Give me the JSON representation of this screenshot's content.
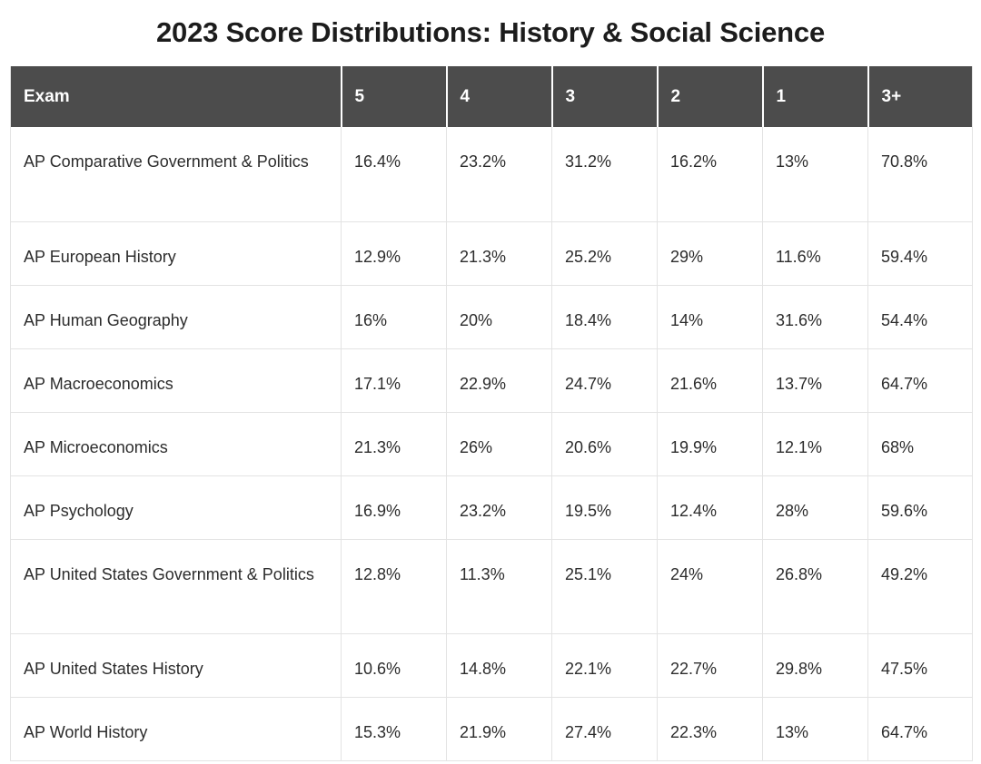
{
  "title": "2023 Score Distributions: History & Social Science",
  "table": {
    "columns": [
      "Exam",
      "5",
      "4",
      "3",
      "2",
      "1",
      "3+"
    ],
    "rows": [
      {
        "exam": "AP Comparative Government & Politics",
        "s5": "16.4%",
        "s4": "23.2%",
        "s3": "31.2%",
        "s2": "16.2%",
        "s1": "13%",
        "s3plus": "70.8%",
        "tall": true
      },
      {
        "exam": "AP European History",
        "s5": "12.9%",
        "s4": "21.3%",
        "s3": "25.2%",
        "s2": "29%",
        "s1": "11.6%",
        "s3plus": "59.4%",
        "tall": false
      },
      {
        "exam": "AP Human Geography",
        "s5": "16%",
        "s4": "20%",
        "s3": "18.4%",
        "s2": "14%",
        "s1": "31.6%",
        "s3plus": "54.4%",
        "tall": false
      },
      {
        "exam": "AP Macroeconomics",
        "s5": "17.1%",
        "s4": "22.9%",
        "s3": "24.7%",
        "s2": "21.6%",
        "s1": "13.7%",
        "s3plus": "64.7%",
        "tall": false
      },
      {
        "exam": "AP Microeconomics",
        "s5": "21.3%",
        "s4": "26%",
        "s3": "20.6%",
        "s2": "19.9%",
        "s1": "12.1%",
        "s3plus": "68%",
        "tall": false
      },
      {
        "exam": "AP Psychology",
        "s5": "16.9%",
        "s4": "23.2%",
        "s3": "19.5%",
        "s2": "12.4%",
        "s1": "28%",
        "s3plus": "59.6%",
        "tall": false
      },
      {
        "exam": "AP United States Government & Politics",
        "s5": "12.8%",
        "s4": "11.3%",
        "s3": "25.1%",
        "s2": "24%",
        "s1": "26.8%",
        "s3plus": "49.2%",
        "tall": true
      },
      {
        "exam": "AP United States History",
        "s5": "10.6%",
        "s4": "14.8%",
        "s3": "22.1%",
        "s2": "22.7%",
        "s1": "29.8%",
        "s3plus": "47.5%",
        "tall": false
      },
      {
        "exam": "AP World History",
        "s5": "15.3%",
        "s4": "21.9%",
        "s3": "27.4%",
        "s2": "22.3%",
        "s1": "13%",
        "s3plus": "64.7%",
        "tall": false
      }
    ]
  },
  "colors": {
    "header_background": "#4c4c4c",
    "header_text": "#ffffff",
    "body_text": "#2c2c2c",
    "title_text": "#1c1c1c",
    "border": "#e3e3e3",
    "page_background": "#ffffff"
  }
}
